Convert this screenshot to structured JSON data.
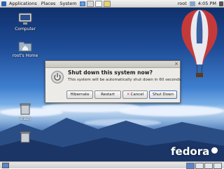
{
  "topbar": {
    "menus": [
      "Applications",
      "Places",
      "System"
    ],
    "user": "root",
    "clock": "4:05 PM"
  },
  "desktop": {
    "icons": [
      {
        "label": "Computer"
      },
      {
        "label": "root's Home"
      },
      {
        "label": "Trash"
      }
    ],
    "branding": "fedora"
  },
  "dialog": {
    "heading": "Shut down this system now?",
    "message": "This system will be automatically shut down in 60 seconds.",
    "buttons": {
      "hibernate": "Hibernate",
      "restart": "Restart",
      "cancel": "Cancel",
      "shutdown": "Shut Down"
    },
    "close_glyph": "×"
  },
  "colors": {
    "panel": "#e0e0e0",
    "dialog_bg": "#ecebe8",
    "accent": "#4a74b6",
    "sky": "#1e4b96"
  }
}
